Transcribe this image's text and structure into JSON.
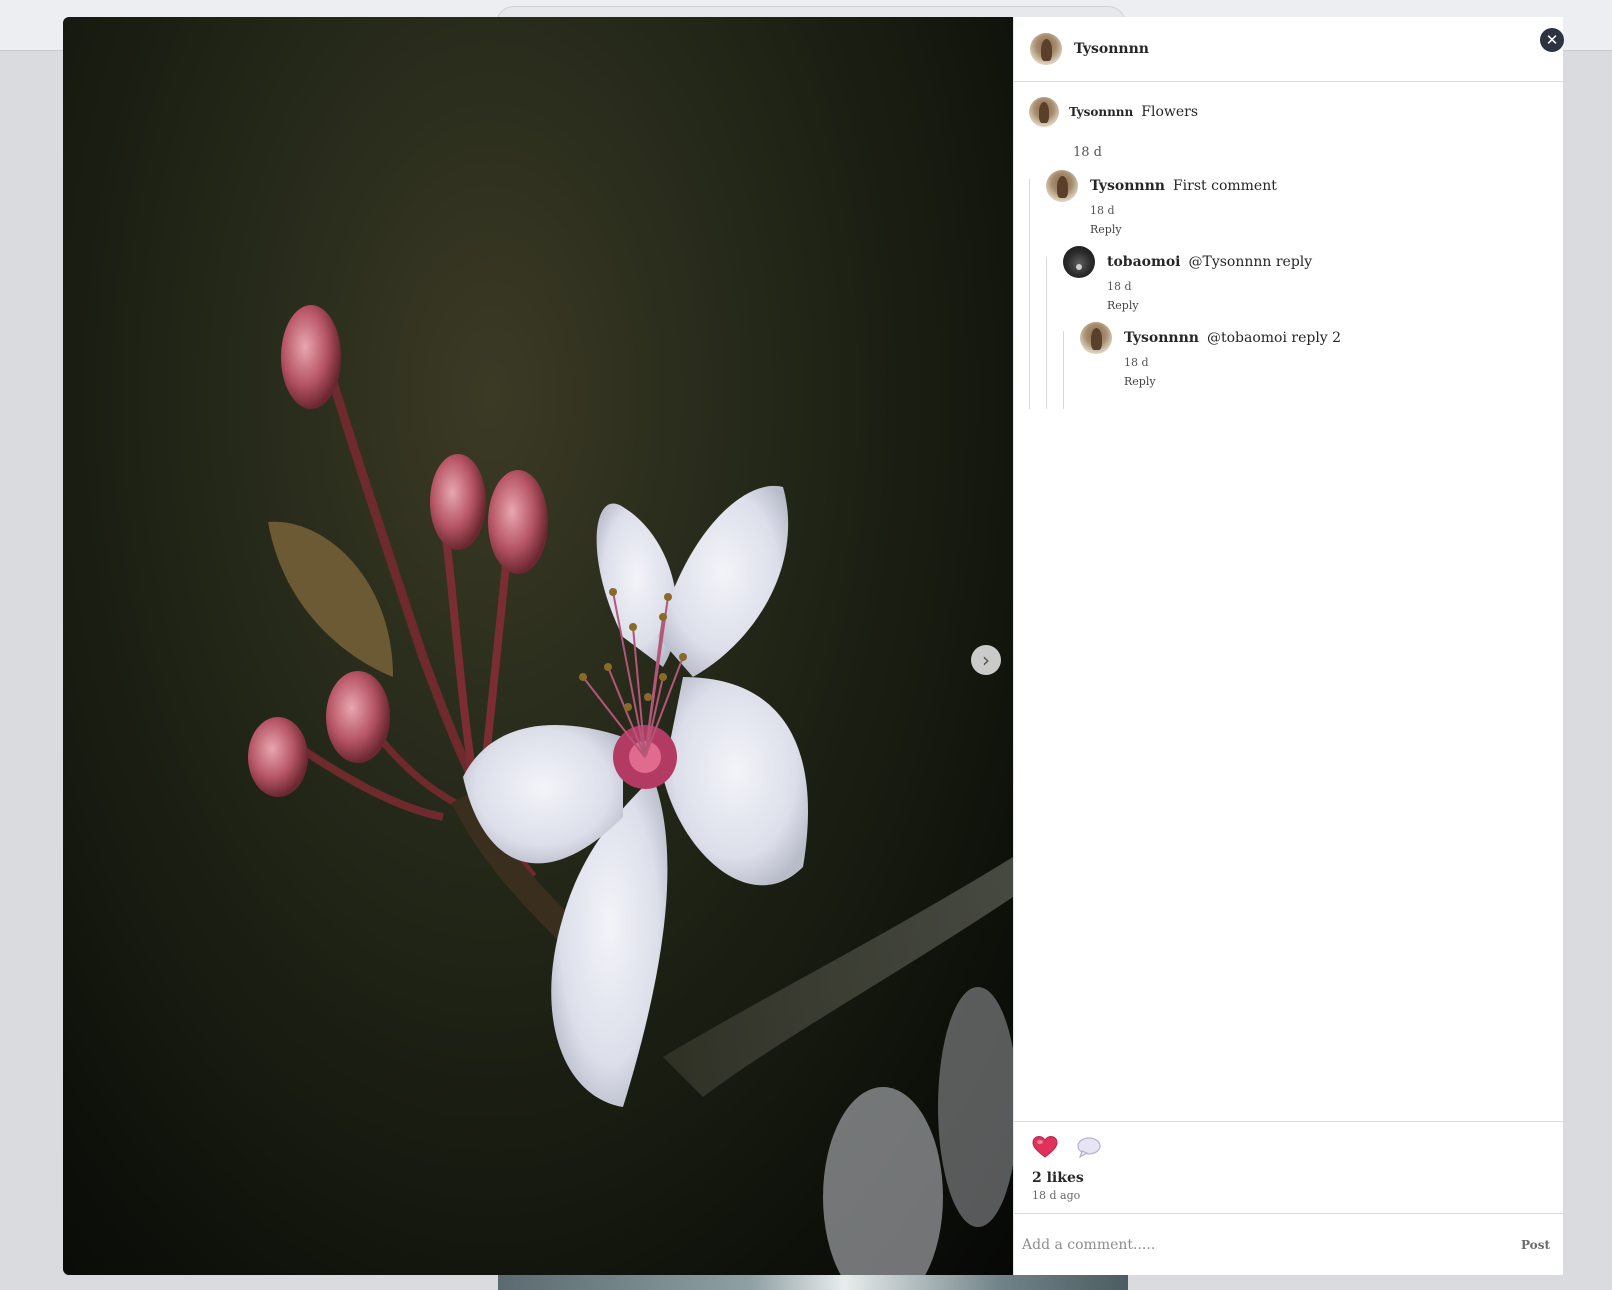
{
  "post": {
    "author": "Tysonnnn",
    "caption_user": "Tysonnnn",
    "caption_text": "Flowers",
    "caption_time": "18 d",
    "likes": "2 likes",
    "posted_ago": "18 d ago"
  },
  "comments": [
    {
      "user": "Tysonnnn",
      "text": "First comment",
      "time": "18 d",
      "reply_label": "Reply"
    },
    {
      "user": "tobaomoi",
      "text": "@Tysonnnn reply",
      "time": "18 d",
      "reply_label": "Reply"
    },
    {
      "user": "Tysonnnn",
      "text": "@tobaomoi reply 2",
      "time": "18 d",
      "reply_label": "Reply"
    }
  ],
  "composer": {
    "placeholder": "Add a comment.....",
    "post_label": "Post"
  },
  "icons": {
    "close": "close-icon",
    "next": "chevron-right-icon",
    "like": "heart-icon",
    "comment": "comment-icon"
  },
  "colors": {
    "heart": "#e0315a",
    "close_bg": "#2d3340"
  }
}
